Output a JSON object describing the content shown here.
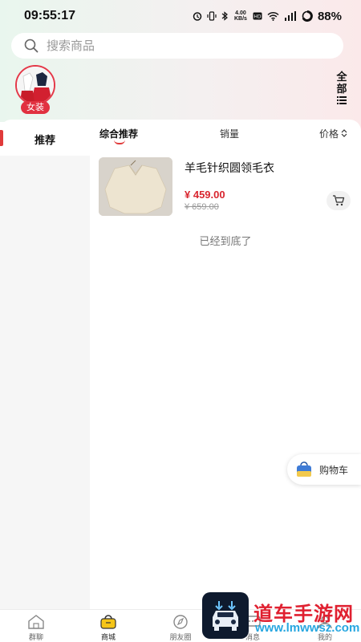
{
  "status_bar": {
    "time": "09:55:17",
    "net_speed": "4.00 KB/s",
    "battery": "88%"
  },
  "search": {
    "placeholder": "搜索商品"
  },
  "category": {
    "label": "女装"
  },
  "all_button": {
    "label_line1": "全",
    "label_line2": "部"
  },
  "left_tab": {
    "label": "推荐"
  },
  "sort": {
    "items": [
      "综合推荐",
      "销量",
      "价格"
    ],
    "active": "综合推荐"
  },
  "product": {
    "title": "羊毛针织圆领毛衣",
    "price": "¥ 459.00",
    "original_price": "¥ 659.00"
  },
  "end_text": "已经到底了",
  "float_cart": {
    "label": "购物车"
  },
  "tabbar": {
    "items": [
      {
        "label": "群聊",
        "icon": "home-icon"
      },
      {
        "label": "商城",
        "icon": "shopping-bag-icon"
      },
      {
        "label": "朋友圈",
        "icon": "compass-icon"
      },
      {
        "label": "消息",
        "icon": "message-icon"
      },
      {
        "label": "我的",
        "icon": "user-icon"
      }
    ],
    "active_index": 1
  },
  "watermark": {
    "title": "道车手游网",
    "url": "www.lmwwsz.com"
  },
  "colors": {
    "accent": "#e03a3a",
    "price": "#d9262f",
    "watermark_red": "#e02030",
    "watermark_blue": "#28a7e0"
  }
}
